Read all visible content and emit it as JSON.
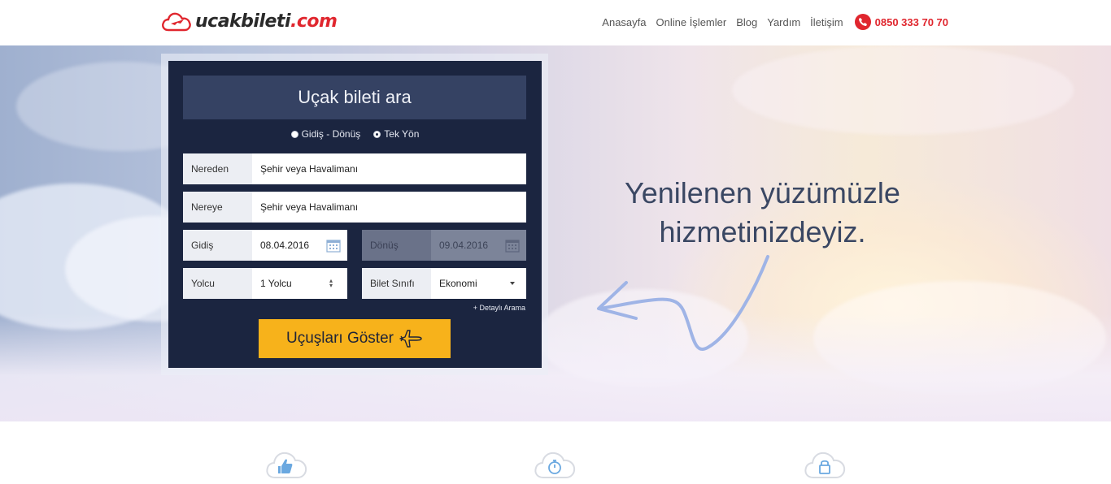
{
  "header": {
    "logo": {
      "brand": "ucakbileti",
      "tld": ".com"
    },
    "nav": [
      {
        "label": "Anasayfa"
      },
      {
        "label": "Online İşlemler"
      },
      {
        "label": "Blog"
      },
      {
        "label": "Yardım"
      },
      {
        "label": "İletişim"
      }
    ],
    "phone": "0850 333 70 70",
    "accent_color": "#e0262e"
  },
  "search": {
    "title": "Uçak bileti ara",
    "trip_types": [
      {
        "label": "Gidiş - Dönüş",
        "selected": false
      },
      {
        "label": "Tek Yön",
        "selected": true
      }
    ],
    "from": {
      "label": "Nereden",
      "placeholder": "Şehir veya Havalimanı"
    },
    "to": {
      "label": "Nereye",
      "placeholder": "Şehir veya Havalimanı"
    },
    "departure": {
      "label": "Gidiş",
      "value": "08.04.2016"
    },
    "return": {
      "label": "Dönüş",
      "value": "09.04.2016",
      "disabled": true
    },
    "passengers": {
      "label": "Yolcu",
      "value": "1 Yolcu"
    },
    "class": {
      "label": "Bilet Sınıfı",
      "value": "Ekonomi"
    },
    "detail_link": "+ Detaylı Arama",
    "submit_label": "Uçuşları Göster",
    "button_color": "#f7b21b",
    "panel_color": "#1b2540"
  },
  "hero": {
    "slogan_line1": "Yenilenen yüzümüzle",
    "slogan_line2": "hizmetinizdeyiz."
  },
  "features": [
    {
      "icon": "thumbs-up-icon"
    },
    {
      "icon": "stopwatch-icon"
    },
    {
      "icon": "lock-icon"
    }
  ]
}
